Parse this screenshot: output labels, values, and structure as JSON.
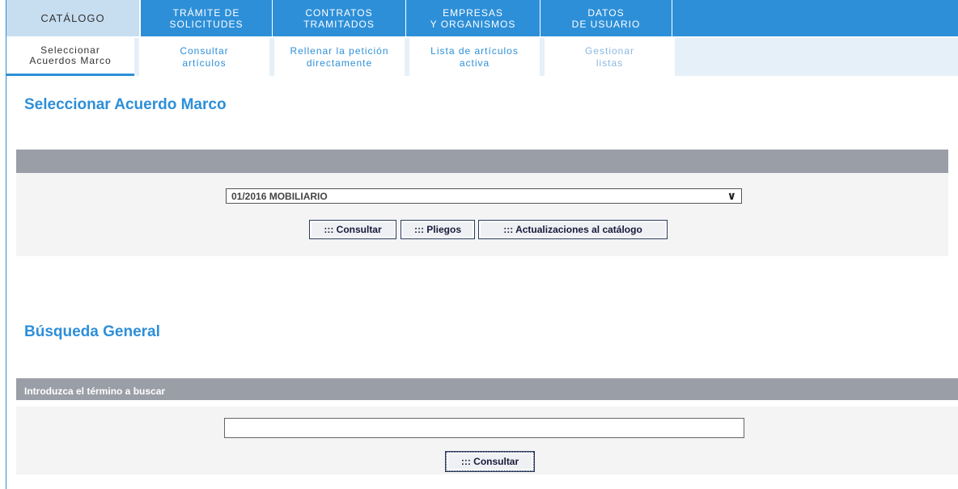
{
  "topnav": {
    "tabs": [
      {
        "label": "CATÁLOGO"
      },
      {
        "label": "TRÁMITE DE\nSOLICITUDES"
      },
      {
        "label": "CONTRATOS\nTRAMITADOS"
      },
      {
        "label": "EMPRESAS\nY ORGANISMOS"
      },
      {
        "label": "DATOS\nDE USUARIO"
      }
    ]
  },
  "subnav": {
    "items": [
      {
        "label": "Seleccionar\nAcuerdos Marco"
      },
      {
        "label": "Consultar\nartículos"
      },
      {
        "label": "Rellenar la petición\ndirectamente"
      },
      {
        "label": "Lista de artículos\nactiva"
      },
      {
        "label": "Gestionar\nlistas"
      }
    ]
  },
  "acuerdo": {
    "title": "Seleccionar Acuerdo Marco",
    "select_value": "01/2016 MOBILIARIO",
    "buttons": {
      "consultar": "::: Consultar",
      "pliegos": "::: Pliegos",
      "actualizaciones": "::: Actualizaciones al catálogo"
    }
  },
  "busqueda": {
    "title": "Búsqueda General",
    "label": "Introduzca el término a buscar",
    "input_value": "",
    "consultar": "::: Consultar"
  }
}
